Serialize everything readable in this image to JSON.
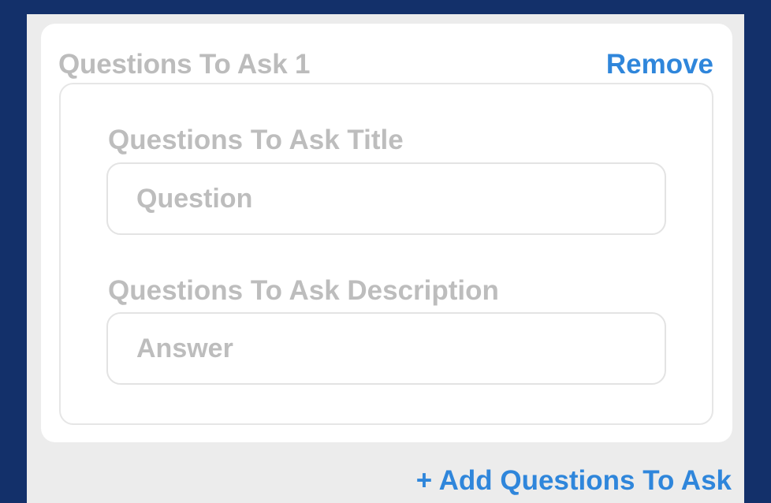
{
  "question_card": {
    "title": "Questions To Ask 1",
    "remove_label": "Remove",
    "fields": {
      "title_label": "Questions To Ask Title",
      "title_placeholder": "Question",
      "description_label": "Questions To Ask Description",
      "description_placeholder": "Answer"
    }
  },
  "actions": {
    "add_label": "+ Add Questions To Ask"
  },
  "colors": {
    "page_background": "#13306a",
    "panel_background": "#ececec",
    "card_background": "#ffffff",
    "accent": "#2f86db",
    "muted_text": "#bdbdbd"
  }
}
